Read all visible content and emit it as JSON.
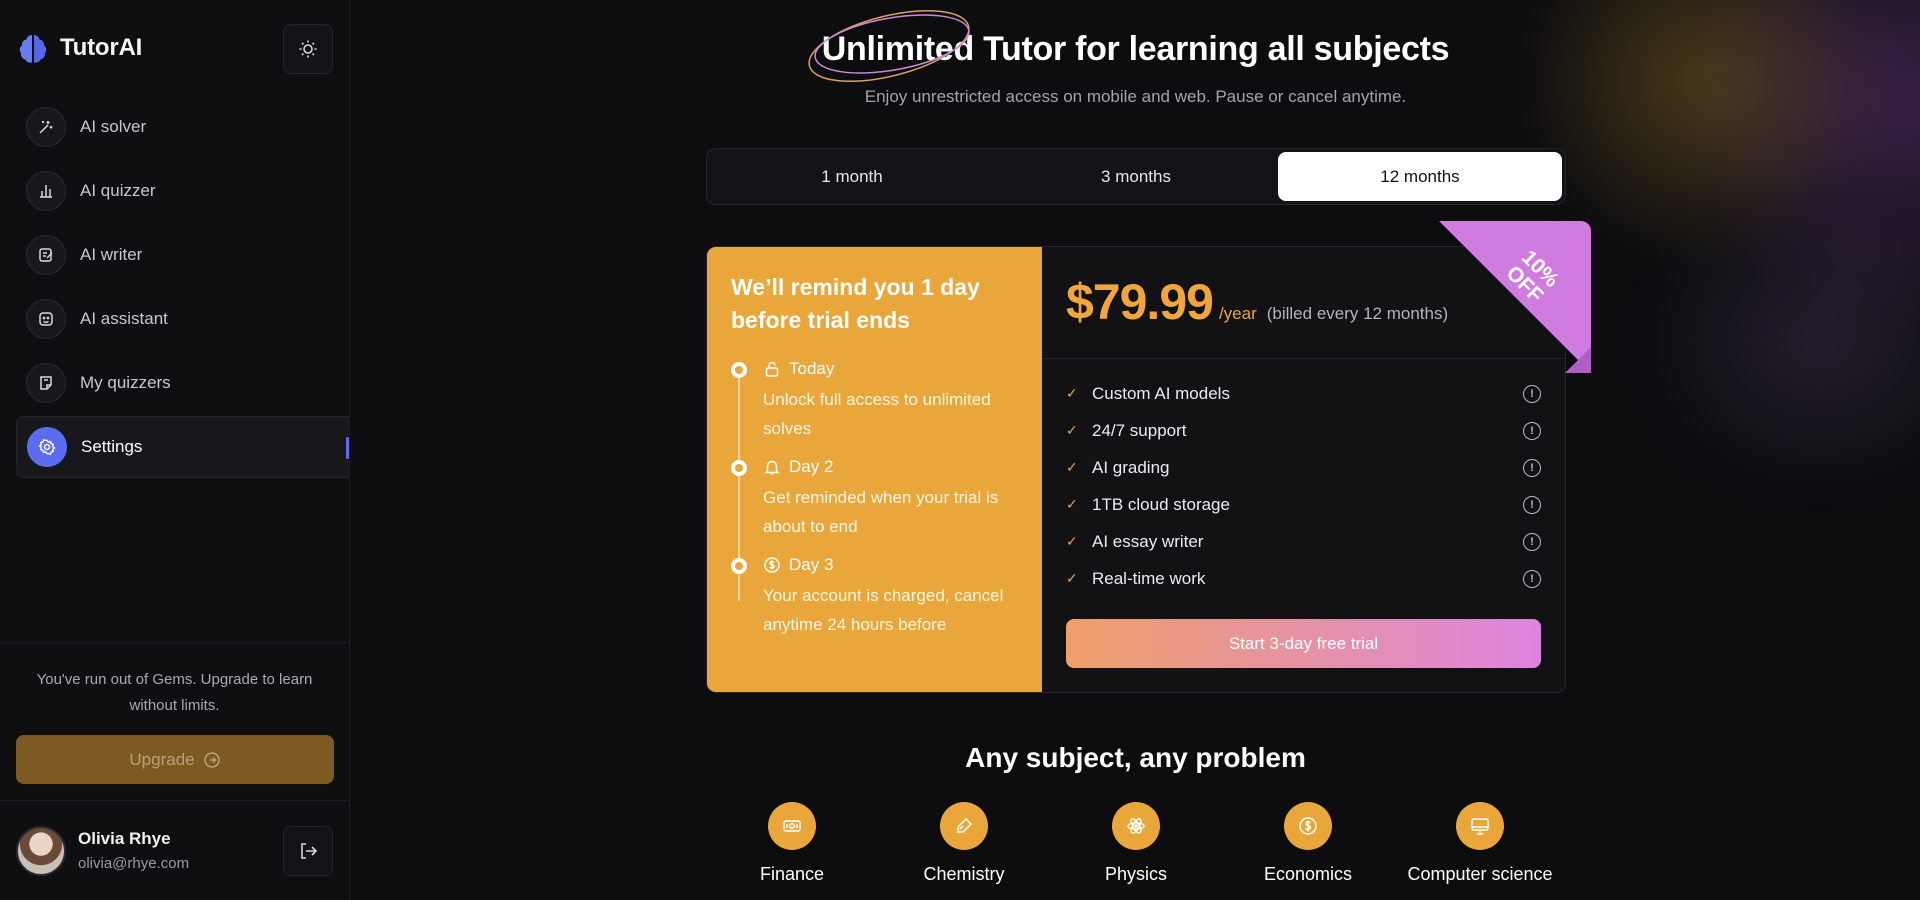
{
  "app": {
    "name": "TutorAI"
  },
  "sidebar": {
    "items": [
      {
        "label": "AI solver",
        "icon": "sparkle-wand-icon"
      },
      {
        "label": "AI quizzer",
        "icon": "bar-chart-icon"
      },
      {
        "label": "AI writer",
        "icon": "edit-note-icon"
      },
      {
        "label": "AI assistant",
        "icon": "bot-face-icon"
      },
      {
        "label": "My quizzers",
        "icon": "note-icon"
      },
      {
        "label": "Settings",
        "icon": "gear-icon",
        "active": true
      }
    ],
    "gems_text": "You've run out of Gems. Upgrade to learn without limits.",
    "upgrade_label": "Upgrade",
    "user": {
      "name": "Olivia Rhye",
      "email": "olivia@rhye.com"
    }
  },
  "header": {
    "title": "Unlimited Tutor for learning all subjects",
    "subtitle": "Enjoy unrestricted access on mobile and web. Pause or cancel anytime."
  },
  "tabs": [
    {
      "label": "1 month"
    },
    {
      "label": "3 months"
    },
    {
      "label": "12 months",
      "selected": true
    }
  ],
  "plan": {
    "remind_title": "We’ll remind you 1 day before trial ends",
    "steps": [
      {
        "title": "Today",
        "text": "Unlock full access to unlimited solves",
        "icon": "lock-icon"
      },
      {
        "title": "Day 2",
        "text": "Get reminded when your trial is about to end",
        "icon": "bell-icon"
      },
      {
        "title": "Day 3",
        "text": "Your account is charged, cancel anytime 24 hours before",
        "icon": "dollar-icon"
      }
    ],
    "price": "$79.99",
    "period": "/year",
    "billed": "(billed every 12 months)",
    "discount_line1": "10%",
    "discount_line2": "OFF",
    "features": [
      "Custom AI models",
      "24/7 support",
      "AI grading",
      "1TB cloud storage",
      "AI essay writer",
      "Real-time work"
    ],
    "cta": "Start 3-day free trial"
  },
  "subjects": {
    "title": "Any subject, any problem",
    "items": [
      {
        "label": "Finance",
        "icon": "money-icon"
      },
      {
        "label": "Chemistry",
        "icon": "pipette-icon"
      },
      {
        "label": "Physics",
        "icon": "atom-icon"
      },
      {
        "label": "Economics",
        "icon": "coin-icon"
      },
      {
        "label": "Computer science",
        "icon": "monitor-icon"
      }
    ]
  },
  "colors": {
    "accent": "#e9a73b",
    "brand": "#5b6cf0",
    "ribbon": "#d07be0"
  }
}
